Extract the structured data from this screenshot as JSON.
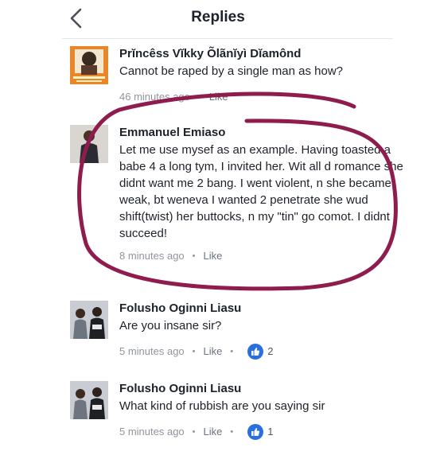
{
  "header": {
    "title": "Replies"
  },
  "comments": [
    {
      "name": "Prĭncêss Vĭkky Õlãnĭyì Dĭamônd",
      "text": "Cannot be raped by a single man as how?",
      "time": "46 minutes ago",
      "like": "Like"
    },
    {
      "name": "Emmanuel Emiaso",
      "text": "Let me use mysef as an example. Having toasted a babe 4 a long tym, I invited her. Wit all d romance she didnt want me 2 bang. I went violent, n she became weak, bt weneva I wanted 2 penetrate she wud shift(twist) her buttocks, n my \"tin\" go comot. I didnt succeed!",
      "time": "8 minutes ago",
      "like": "Like"
    },
    {
      "name": "Folusho Oginni Liasu",
      "text": "Are you insane sir?",
      "time": "5 minutes ago",
      "like": "Like",
      "reaction_count": "2"
    },
    {
      "name": "Folusho Oginni Liasu",
      "text": "What kind of rubbish are you saying sir",
      "time": "5 minutes ago",
      "like": "Like",
      "reaction_count": "1"
    }
  ],
  "colors": {
    "annotation": "#8e1d4e",
    "like_reaction": "#2a6fe0",
    "meta_text": "#90949c"
  },
  "icons": {
    "back": "chevron-left-icon",
    "reaction": "thumbs-up-icon"
  }
}
